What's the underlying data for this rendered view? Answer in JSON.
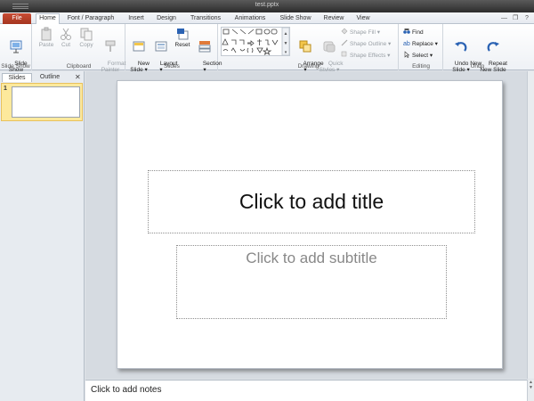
{
  "window": {
    "title": "test.pptx"
  },
  "tabs": [
    {
      "label": "File"
    },
    {
      "label": "Home"
    },
    {
      "label": "Font / Paragraph"
    },
    {
      "label": "Insert"
    },
    {
      "label": "Design"
    },
    {
      "label": "Transitions"
    },
    {
      "label": "Animations"
    },
    {
      "label": "Slide Show"
    },
    {
      "label": "Review"
    },
    {
      "label": "View"
    }
  ],
  "window_controls": {
    "minimize": "—",
    "restore": "❐",
    "help": "?"
  },
  "ribbon": {
    "slideshow": {
      "button": "Slide\nShow",
      "group": "Slide Show"
    },
    "clipboard": {
      "paste": "Paste",
      "cut": "Cut",
      "copy": "Copy",
      "format_painter": "Format\nPainter",
      "group": "Clipboard"
    },
    "slides": {
      "new_slide": "New\nSlide ▾",
      "layout": "Layout\n▾",
      "reset": "Reset",
      "section": "Section\n▾",
      "group": "Slides"
    },
    "drawing": {
      "arrange": "Arrange\n▾",
      "quick_styles": "Quick\nStyles ▾",
      "shape_fill": "Shape Fill ▾",
      "shape_outline": "Shape Outline ▾",
      "shape_effects": "Shape Effects ▾",
      "group": "Drawing"
    },
    "editing": {
      "find": "Find",
      "replace": "Replace ▾",
      "select": "Select ▾",
      "group": "Editing"
    },
    "undo": {
      "undo": "Undo New\nSlide ▾",
      "repeat": "Repeat\nNew Slide",
      "group": "Undo"
    }
  },
  "panel": {
    "tab_slides": "Slides",
    "tab_outline": "Outline",
    "close": "✕",
    "slide_number": "1"
  },
  "slide": {
    "title_placeholder": "Click to add title",
    "subtitle_placeholder": "Click to add subtitle"
  },
  "notes": {
    "placeholder": "Click to add notes"
  },
  "colors": {
    "file_tab": "#b8412a",
    "accent": "#2a62b3",
    "thumb_selected": "#fde99c"
  }
}
